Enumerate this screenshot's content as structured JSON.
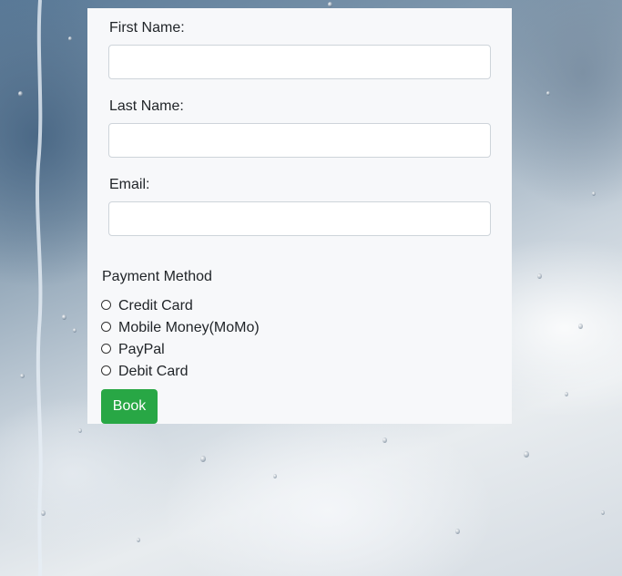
{
  "form": {
    "first_name_label": "First Name:",
    "first_name_value": "",
    "last_name_label": "Last Name:",
    "last_name_value": "",
    "email_label": "Email:",
    "email_value": "",
    "payment_method_label": "Payment Method",
    "payment_options": [
      {
        "label": "Credit Card",
        "selected": false
      },
      {
        "label": "Mobile Money(MoMo)",
        "selected": false
      },
      {
        "label": "PayPal",
        "selected": false
      },
      {
        "label": "Debit Card",
        "selected": false
      }
    ],
    "submit_label": "Book"
  },
  "colors": {
    "panel_background": "#f7f8fa",
    "button_background": "#28a745",
    "button_text": "#ffffff",
    "input_border": "#ced4da",
    "text": "#212529"
  }
}
